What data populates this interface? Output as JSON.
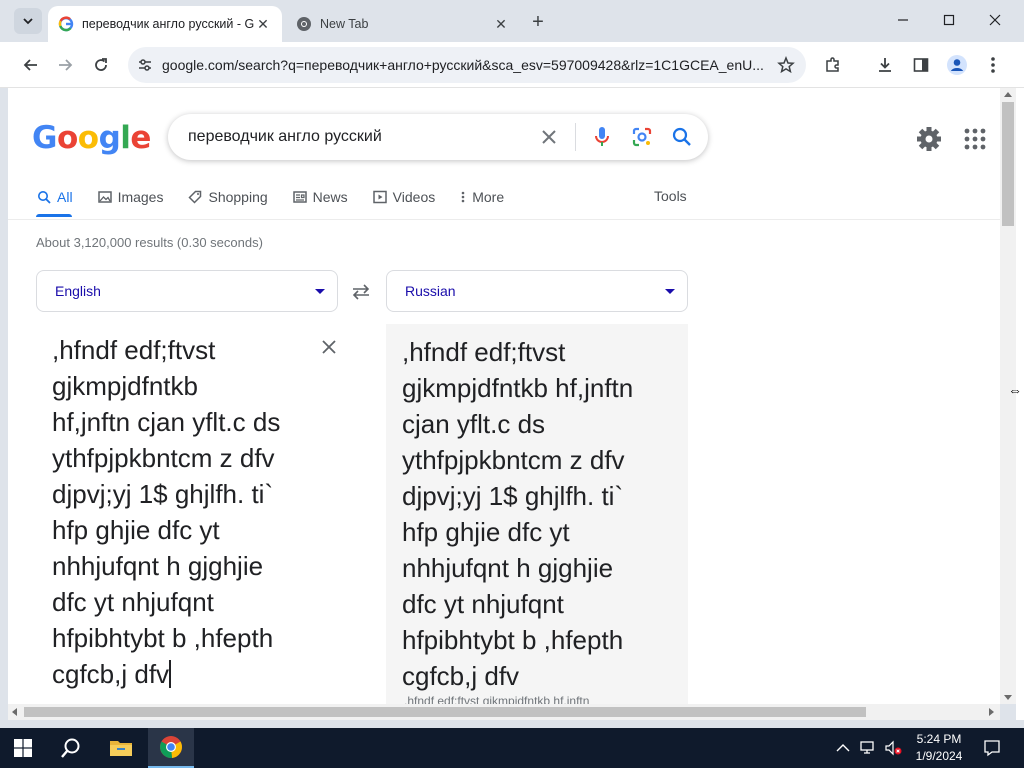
{
  "browser": {
    "tabs": [
      {
        "title": "переводчик англо русский - Google",
        "active": true
      },
      {
        "title": "New Tab",
        "active": false
      }
    ],
    "url": "google.com/search?q=переводчик+англо+русский&sca_esv=597009428&rlz=1C1GCEA_enU..."
  },
  "google": {
    "logo": "Google",
    "query": "переводчик англо русский",
    "nav": [
      {
        "label": "All",
        "icon": "search-icon",
        "active": true
      },
      {
        "label": "Images",
        "icon": "image-icon",
        "active": false
      },
      {
        "label": "Shopping",
        "icon": "tag-icon",
        "active": false
      },
      {
        "label": "News",
        "icon": "news-icon",
        "active": false
      },
      {
        "label": "Videos",
        "icon": "play-icon",
        "active": false
      },
      {
        "label": "More",
        "icon": "more-vert-icon",
        "active": false
      }
    ],
    "tools_label": "Tools",
    "result_stats": "About 3,120,000 results (0.30 seconds)"
  },
  "translate": {
    "source_lang": "English",
    "target_lang": "Russian",
    "source_text": ",hfndf edf;ftvst\ngjkmpjdfntkb\nhf,jnftn cjan yflt.c ds\nythfpjpkbntcm z dfv\ndjpvj;yj 1$ ghjlfh. ti`\nhfp ghjie dfc yt\nnhhjufqnt h gjghjie\ndfc yt nhjufqnt\nhfpibhtybt b ,hfepth\ncgfcb,j dfv",
    "target_text": ",hfndf edf;ftvst\ngjkmpjdfntkb hf,jnftn\ncjan yflt.c ds\nythfpjpkbntcm z dfv\ndjpvj;yj 1$ ghjlfh. ti`\nhfp ghjie dfc yt\nnhhjufqnt h gjghjie\ndfc yt nhjufqnt\nhfpibhtybt b ,hfepth\ncgfcb,j dfv",
    "target_translit": ",hfndf edf;ftvst gjkmpjdfntkb hf,jnftn"
  },
  "taskbar": {
    "time": "5:24 PM",
    "date": "1/9/2024"
  },
  "colors": {
    "accent": "#1a73e8",
    "link": "#1a0dab",
    "taskbar": "#0f1a2c"
  }
}
